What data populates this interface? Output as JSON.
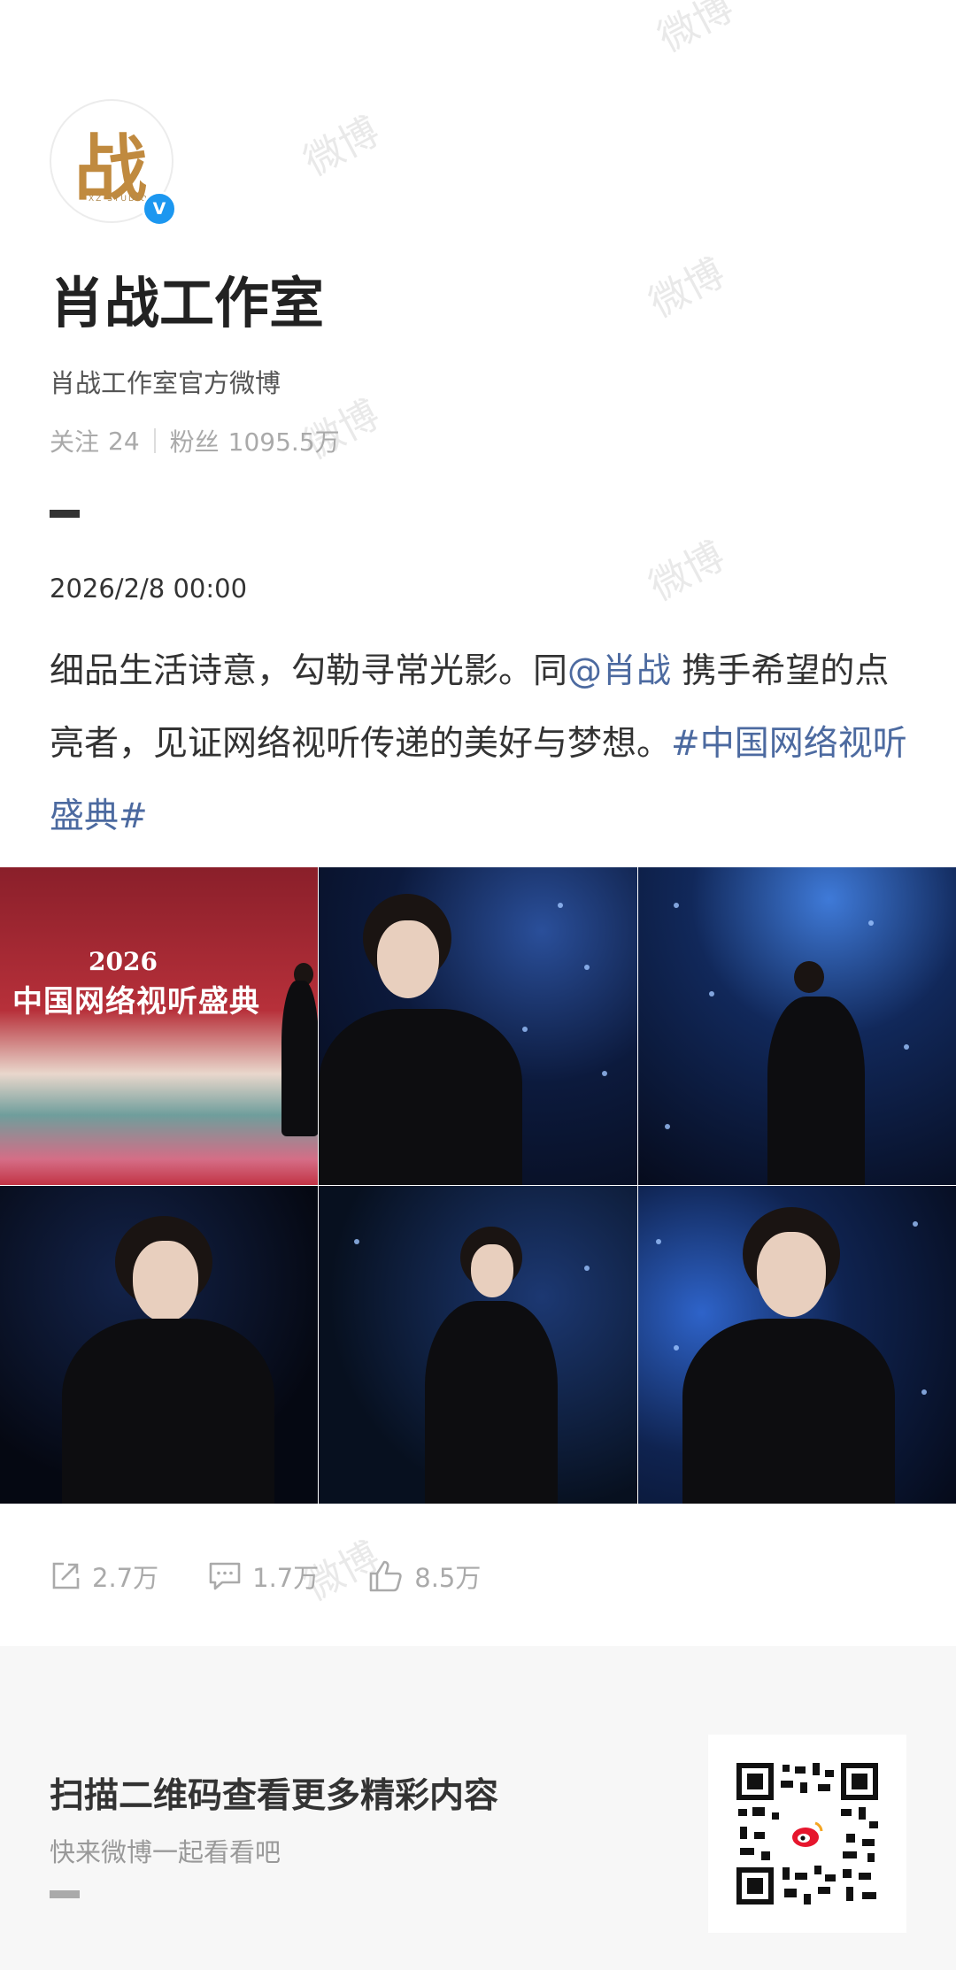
{
  "watermark": "微博",
  "profile": {
    "avatar_glyph": "战",
    "avatar_subtext": "XZ·STUDIO",
    "verified_mark": "V",
    "name": "肖战工作室",
    "bio": "肖战工作室官方微博",
    "following_label": "关注",
    "following_count": "24",
    "followers_label": "粉丝",
    "followers_count": "1095.5万"
  },
  "post": {
    "date": "2026/2/8 00:00",
    "text_part1": "细品生活诗意，勾勒寻常光影。同",
    "mention": "@肖战",
    "text_part2": " 携手希望的点亮者，见证网络视听传递的美好与梦想。",
    "hashtag": "#中国网络视听盛典#",
    "poster_year": "2026",
    "poster_title": "中国网络视听盛典",
    "photos": [
      "photo-1",
      "photo-2",
      "photo-3",
      "photo-4",
      "photo-5",
      "photo-6"
    ]
  },
  "actions": {
    "share_count": "2.7万",
    "comment_count": "1.7万",
    "like_count": "8.5万"
  },
  "footer": {
    "title": "扫描二维码查看更多精彩内容",
    "subtitle": "快来微博一起看看吧"
  },
  "colors": {
    "link": "#4c6aa0",
    "verified": "#1c97f0",
    "weibo_red": "#e6162d"
  }
}
